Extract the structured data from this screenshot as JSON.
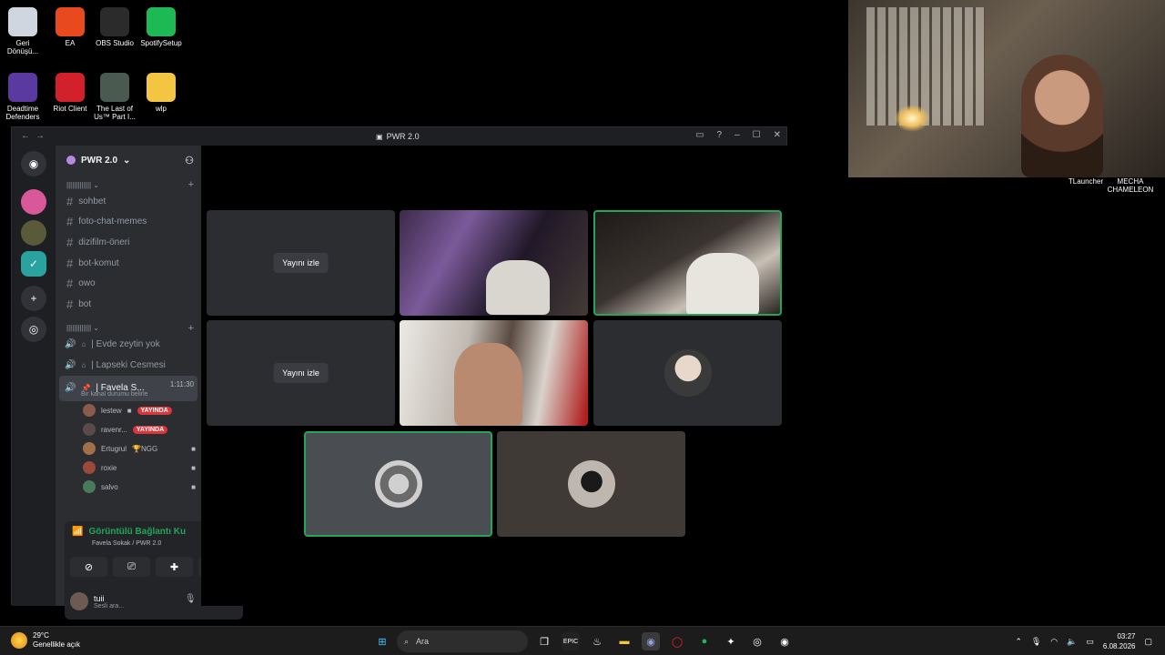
{
  "desktop": {
    "icons": [
      {
        "label": "Geri Dönüşü...",
        "color": "#cfd6e0"
      },
      {
        "label": "EA",
        "color": "#e8491f"
      },
      {
        "label": "OBS Studio",
        "color": "#2b2b2b"
      },
      {
        "label": "SpotifySetup",
        "color": "#1db954"
      },
      {
        "label": "Deadtime Defenders",
        "color": "#5a3aa0"
      },
      {
        "label": "Riot Client",
        "color": "#d4202a"
      },
      {
        "label": "The Last of Us™ Part I...",
        "color": "#4a5a50"
      },
      {
        "label": "wlp",
        "color": "#f4c542"
      }
    ],
    "side_labels": [
      "TLauncher",
      "MECHA CHAMELEON"
    ]
  },
  "window": {
    "title": "PWR 2.0",
    "nav_back": "←",
    "nav_forward": "→",
    "controls": [
      "▭",
      "?",
      "–",
      "☐",
      "✕"
    ]
  },
  "server": {
    "name": "PWR 2.0",
    "text_category": "||||||||||||| ⌄",
    "text_channels": [
      "sohbet",
      "foto-chat-memes",
      "dizifilm-öneri",
      "bot-komut",
      "owo",
      "bot"
    ],
    "voice_category": "||||||||||||| ⌄",
    "voice_channels": [
      {
        "name": "| Evde zeytin yok"
      },
      {
        "name": "| Lapseki Cesmesi"
      }
    ],
    "active_voice": {
      "name": "| Favela S...",
      "time": "1:11:30",
      "status": "Bir kanal durumu belirle"
    },
    "members": [
      {
        "name": "lestew",
        "live": true,
        "badge": ""
      },
      {
        "name": "ravenr...",
        "live": true,
        "badge": ""
      },
      {
        "name": "Ertugrul",
        "live": false,
        "badge": "🏆NGG"
      },
      {
        "name": "roxie",
        "live": false,
        "badge": ""
      },
      {
        "name": "salvo",
        "live": false,
        "badge": ""
      }
    ],
    "live_label": "YAYINDA"
  },
  "voice_panel": {
    "status": "Görüntülü Bağlantı Ku",
    "location": "Favela Sokak / PWR 2.0"
  },
  "user": {
    "name": "tuii",
    "status": "Sesli ara..."
  },
  "stage": {
    "watch_label": "Yayını izle"
  },
  "taskbar": {
    "temp": "29°C",
    "weather": "Genellikle açık",
    "search_placeholder": "Ara",
    "time": "03:27",
    "date": "6.08.2026"
  }
}
